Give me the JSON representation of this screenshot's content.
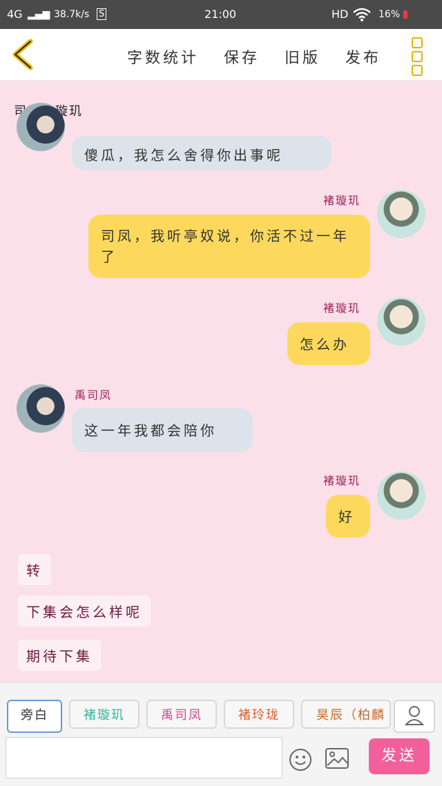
{
  "status_bar": {
    "network": "4G",
    "speed": "38.7k/s",
    "sim_icon": "S",
    "time": "21:00",
    "hd": "HD",
    "battery": "16%"
  },
  "toolbar": {
    "word_count": "字数统计",
    "save": "保存",
    "old_version": "旧版",
    "publish": "发布"
  },
  "chat": {
    "title": "司凤救璇玑",
    "messages": [
      {
        "side": "left",
        "speaker": "",
        "text": "傻瓜，我怎么舍得你出事呢"
      },
      {
        "side": "right",
        "speaker": "褚璇玑",
        "text": "司凤，我听亭奴说，你活不过一年了"
      },
      {
        "side": "right",
        "speaker": "褚璇玑",
        "text": "怎么办"
      },
      {
        "side": "left",
        "speaker": "禹司凤",
        "text": "这一年我都会陪你"
      },
      {
        "side": "right",
        "speaker": "褚璇玑",
        "text": "好"
      }
    ],
    "narrations": [
      "转",
      "下集会怎么样呢",
      "期待下集"
    ]
  },
  "role_tabs": [
    {
      "label": "旁白",
      "color": "#333333",
      "active": true
    },
    {
      "label": "褚璇玑",
      "color": "#36b39a",
      "active": false
    },
    {
      "label": "禹司凤",
      "color": "#d04a8c",
      "active": false
    },
    {
      "label": "褚玲珑",
      "color": "#e05a2a",
      "active": false
    },
    {
      "label": "昊辰（柏麟",
      "color": "#c96a2a",
      "active": false
    }
  ],
  "input": {
    "placeholder": ""
  },
  "send_label": "发送",
  "colors": {
    "accent": "#f35f9a",
    "background": "#fbe0ea",
    "bubble_grey": "#dde3ea",
    "bubble_yellow": "#fcd95c"
  }
}
